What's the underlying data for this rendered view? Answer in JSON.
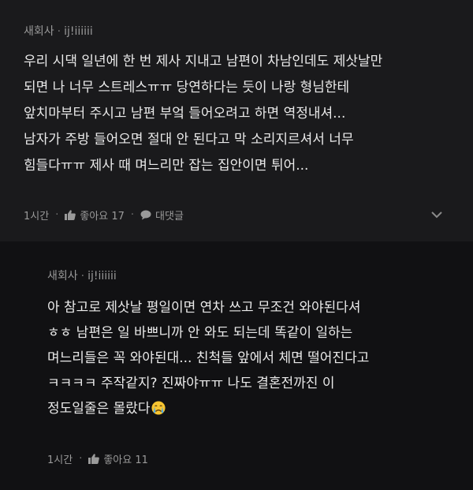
{
  "comments": [
    {
      "author": "새회사",
      "handle": "ij!iiiiii",
      "body": "우리 시댁 일년에 한 번 제사 지내고 남편이 차남인데도 제삿날만\n되면 나 너무 스트레스ㅠㅠ 당연하다는 듯이 나랑 형님한테\n앞치마부터 주시고 남편 부엌 들어오려고 하면 역정내셔...\n남자가 주방 들어오면 절대 안 된다고 막 소리지르셔서 너무\n힘들다ㅠㅠ 제사 때 며느리만 잡는 집안이면 튀어...",
      "time": "1시간",
      "like_label": "좋아요 17",
      "reply_label": "대댓글"
    },
    {
      "author": "새회사",
      "handle": "ij!iiiiii",
      "body": "아 참고로 제삿날 평일이면 연차 쓰고 무조건 와야된다셔\nㅎㅎ 남편은 일 바쁘니까 안 와도 되는데 똑같이 일하는\n며느리들은 꼭 와야된대... 친척들 앞에서 체면 떨어진다고\nㅋㅋㅋㅋ 주작같지? 진짜야ㅠㅠ 나도 결혼전까진 이\n정도일줄은 몰랐다",
      "time": "1시간",
      "like_label": "좋아요 11"
    }
  ],
  "separator": "·",
  "icons": {
    "like": "thumbs-up-icon",
    "reply": "speech-bubble-icon",
    "more": "chevron-down-icon",
    "emoji": "crying-face-emoji-icon"
  },
  "colors": {
    "background": "#111113",
    "top_comment_background": "#1a1a1c",
    "text": "#eaeaea",
    "muted": "#9a9a9a"
  }
}
